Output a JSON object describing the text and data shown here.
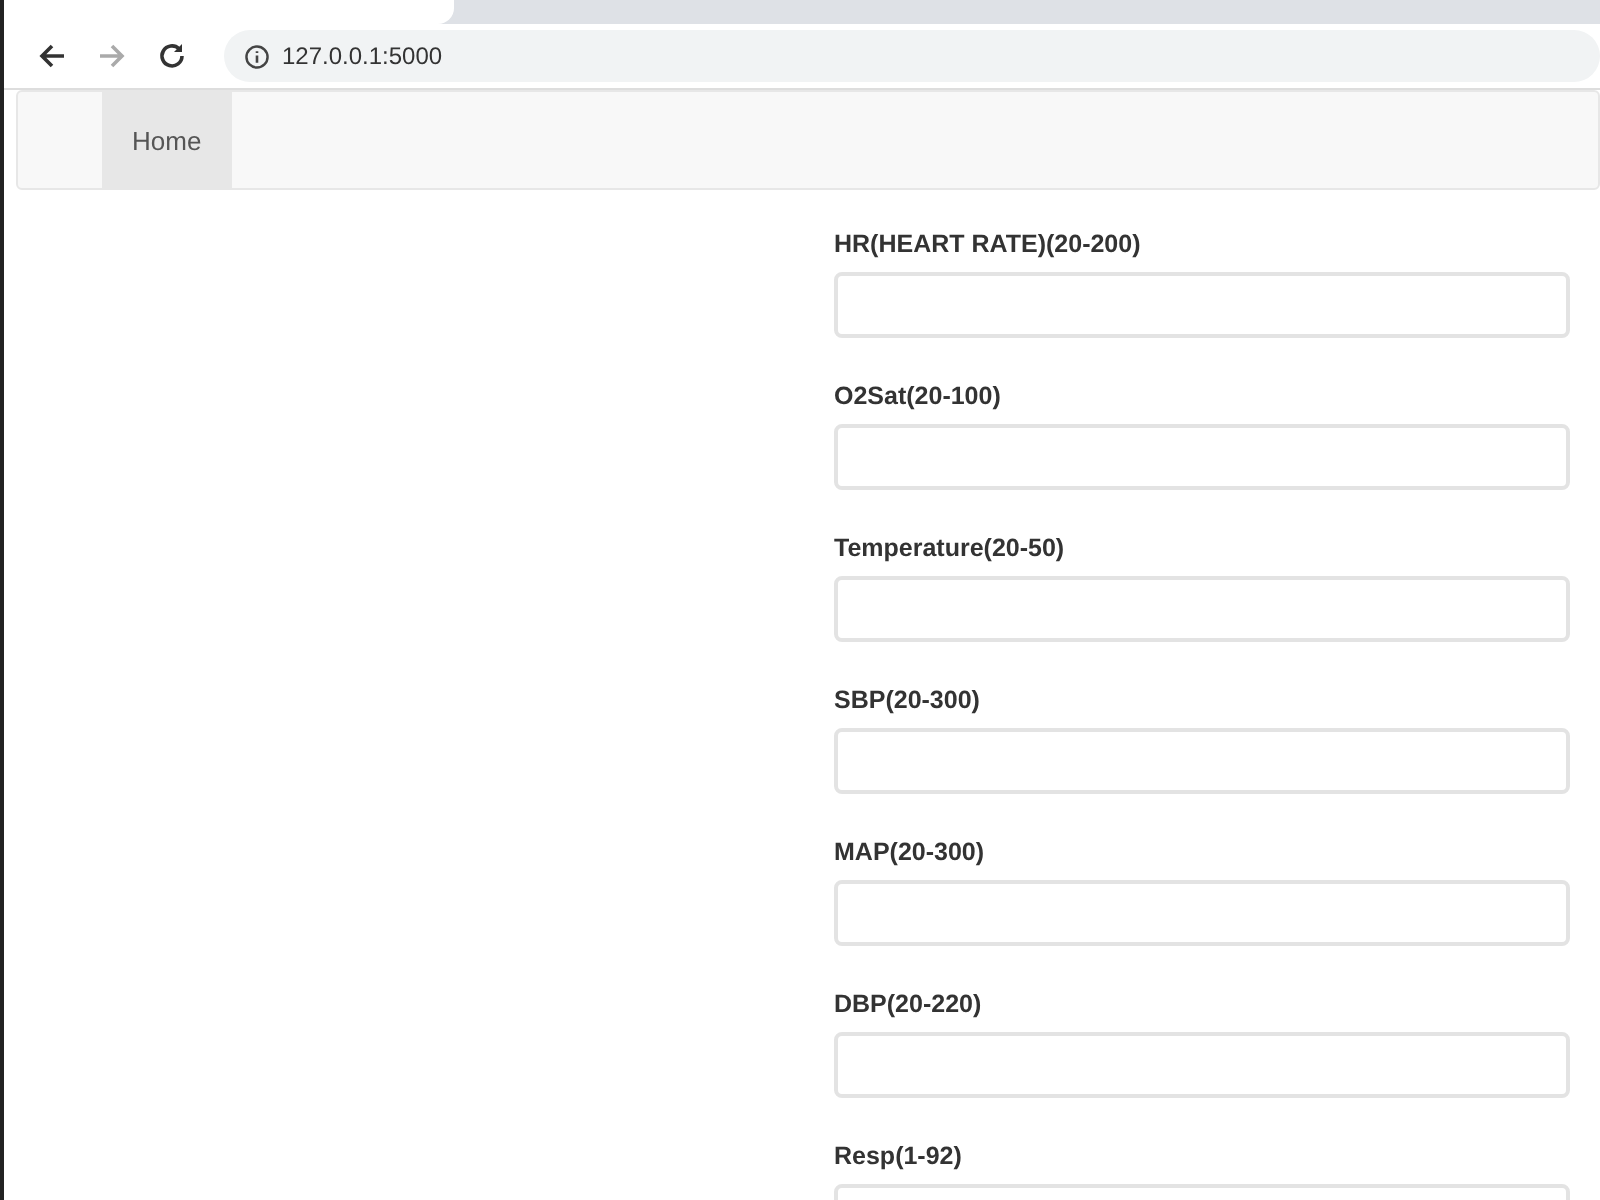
{
  "browser": {
    "address": "127.0.0.1:5000"
  },
  "navbar": {
    "items": [
      {
        "label": "Home",
        "selected": true
      }
    ]
  },
  "form": {
    "fields": [
      {
        "label": "HR(HEART RATE)(20-200)"
      },
      {
        "label": "O2Sat(20-100)"
      },
      {
        "label": "Temperature(20-50)"
      },
      {
        "label": "SBP(20-300)"
      },
      {
        "label": "MAP(20-300)"
      },
      {
        "label": "DBP(20-220)"
      },
      {
        "label": "Resp(1-92)"
      }
    ]
  }
}
